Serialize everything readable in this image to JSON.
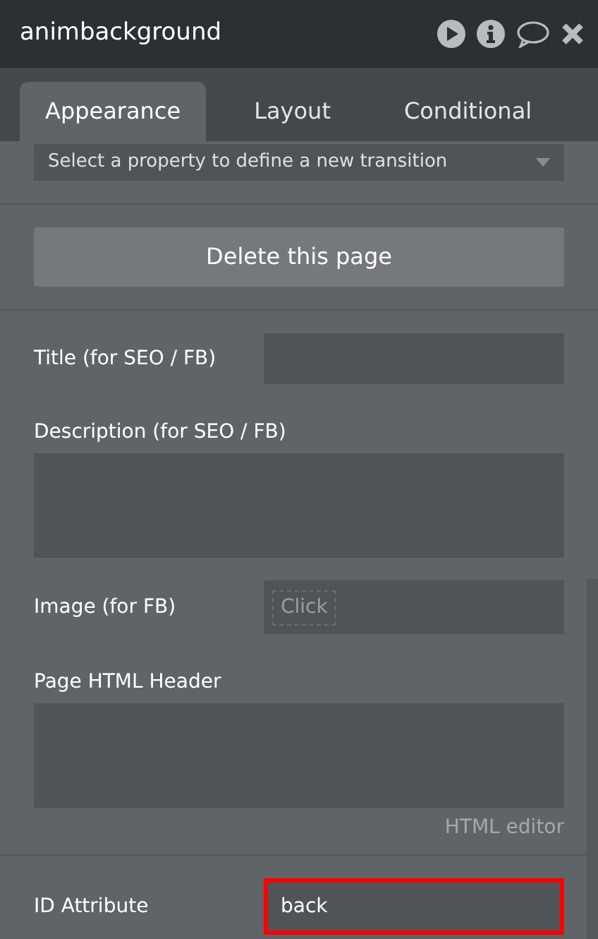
{
  "window": {
    "title": "animbackground"
  },
  "tabs": [
    {
      "label": "Appearance",
      "selected": true
    },
    {
      "label": "Layout",
      "selected": false
    },
    {
      "label": "Conditional",
      "selected": false
    }
  ],
  "transition_dropdown": {
    "placeholder": "Select a property to define a new transition"
  },
  "delete_button": "Delete this page",
  "fields": [
    {
      "kind": "input",
      "label": "Title (for SEO / FB)"
    },
    {
      "kind": "textarea",
      "label": "Description (for SEO / FB)"
    },
    {
      "kind": "image",
      "label": "Image (for FB)",
      "button": "Click"
    },
    {
      "kind": "textarea",
      "label": "Page HTML Header",
      "link": "HTML editor"
    }
  ],
  "id_attribute": {
    "label": "ID Attribute",
    "value": "back",
    "highlighted": true
  }
}
